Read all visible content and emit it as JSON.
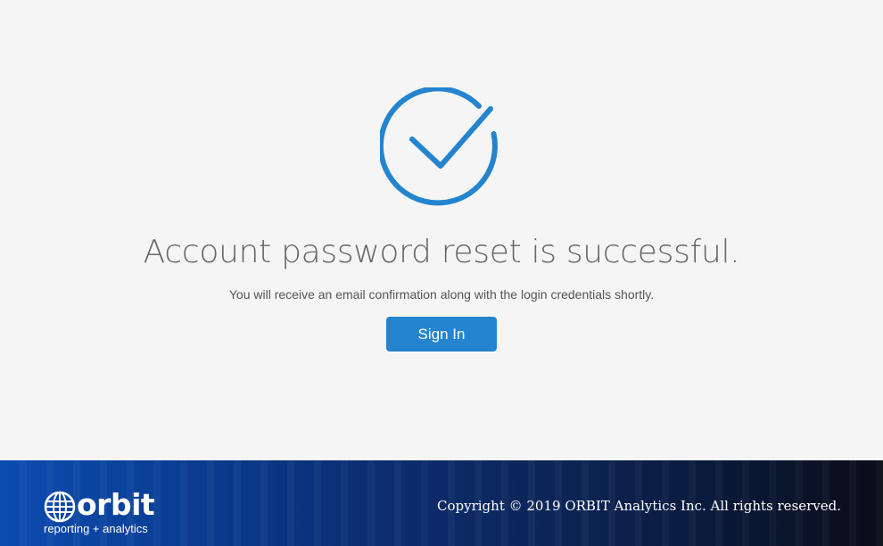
{
  "main": {
    "icon": "check-circle-icon",
    "headline": "Account password reset is successful.",
    "subtext": "You will receive an email confirmation along with the login credentials shortly.",
    "signin_label": "Sign In",
    "accent_color": "#2484cf"
  },
  "footer": {
    "logo_icon": "globe-icon",
    "logo_word": "orbit",
    "logo_tagline": "reporting + analytics",
    "copyright": "Copyright © 2019 ORBIT Analytics Inc. All rights reserved."
  }
}
